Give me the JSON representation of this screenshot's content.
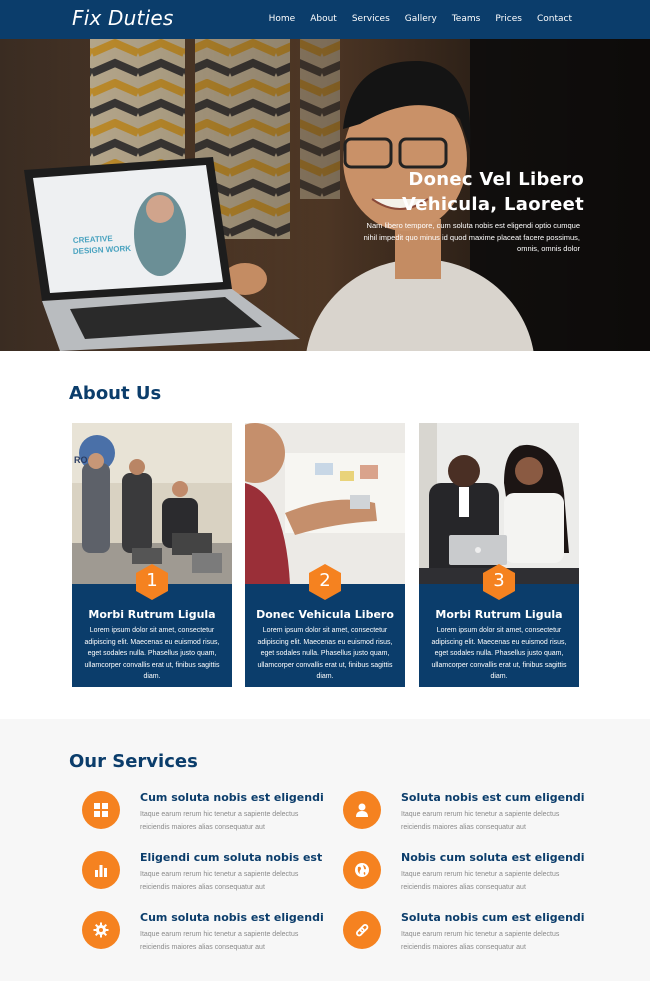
{
  "brand": "Fix Duties",
  "nav": [
    "Home",
    "About",
    "Services",
    "Gallery",
    "Teams",
    "Prices",
    "Contact"
  ],
  "hero": {
    "title_line1": "Donec Vel Libero",
    "title_line2": "Vehicula, Laoreet",
    "text": "Nam libero tempore, cum soluta nobis est eligendi optio cumque nihil impedit quo minus id quod maxime placeat facere possimus, omnis, omnis dolor",
    "laptop_screen_line1": "CREATIVE",
    "laptop_screen_line2": "DESIGN WORK"
  },
  "about": {
    "title": "About Us",
    "cards": [
      {
        "number": "1",
        "title": "Morbi Rutrum Ligula",
        "text": "Lorem ipsum dolor sit amet, consectetur adipiscing elit. Maecenas eu euismod risus, eget sodales nulla. Phasellus justo quam, ullamcorper convallis erat ut, finibus sagittis diam.",
        "sign": "ROCO"
      },
      {
        "number": "2",
        "title": "Donec Vehicula Libero",
        "text": "Lorem ipsum dolor sit amet, consectetur adipiscing elit. Maecenas eu euismod risus, eget sodales nulla. Phasellus justo quam, ullamcorper convallis erat ut, finibus sagittis diam."
      },
      {
        "number": "3",
        "title": "Morbi Rutrum Ligula",
        "text": "Lorem ipsum dolor sit amet, consectetur adipiscing elit. Maecenas eu euismod risus, eget sodales nulla. Phasellus justo quam, ullamcorper convallis erat ut, finibus sagittis diam."
      }
    ]
  },
  "services": {
    "title": "Our Services",
    "items": [
      {
        "icon": "grid-icon",
        "title": "Cum soluta nobis est eligendi",
        "text": "Itaque earum rerum hic tenetur a sapiente delectus reiciendis maiores alias consequatur aut"
      },
      {
        "icon": "user-icon",
        "title": "Soluta nobis est cum eligendi",
        "text": "Itaque earum rerum hic tenetur a sapiente delectus reiciendis maiores alias consequatur aut"
      },
      {
        "icon": "bar-chart-icon",
        "title": "Eligendi cum soluta nobis est",
        "text": "Itaque earum rerum hic tenetur a sapiente delectus reiciendis maiores alias consequatur aut"
      },
      {
        "icon": "globe-icon",
        "title": "Nobis cum soluta est eligendi",
        "text": "Itaque earum rerum hic tenetur a sapiente delectus reiciendis maiores alias consequatur aut"
      },
      {
        "icon": "gear-icon",
        "title": "Cum soluta nobis est eligendi",
        "text": "Itaque earum rerum hic tenetur a sapiente delectus reiciendis maiores alias consequatur aut"
      },
      {
        "icon": "link-icon",
        "title": "Soluta nobis cum est eligendi",
        "text": "Itaque earum rerum hic tenetur a sapiente delectus reiciendis maiores alias consequatur aut"
      }
    ]
  },
  "colors": {
    "primary": "#0b3d6b",
    "accent": "#f58220",
    "services_bg": "#f7f7f7"
  }
}
